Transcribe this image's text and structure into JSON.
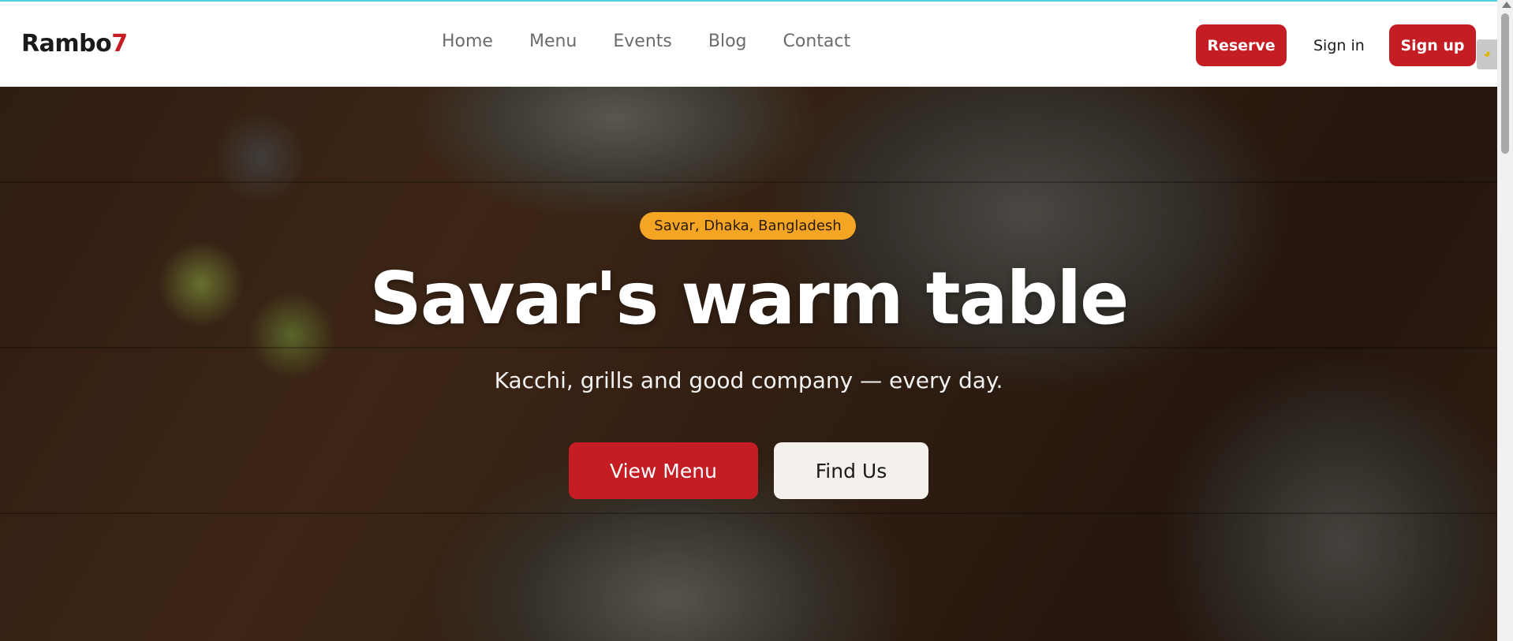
{
  "brand": {
    "name_main": "Rambo",
    "name_accent": "7",
    "accent_color": "#c41e24"
  },
  "nav": {
    "links": [
      "Home",
      "Menu",
      "Events",
      "Blog",
      "Contact"
    ],
    "reserve_label": "Reserve",
    "signin_label": "Sign in",
    "signup_label": "Sign up"
  },
  "hero": {
    "badge": "Savar, Dhaka, Bangladesh",
    "title": "Savar's warm table",
    "subtitle": "Kacchi, grills and good company — every day.",
    "primary_button": "View Menu",
    "secondary_button": "Find Us",
    "background_image": "overhead photo of food on a wooden table"
  },
  "colors": {
    "primary": "#c41e24",
    "badge": "#f5a524",
    "secondary_button": "#f4f1ec"
  }
}
